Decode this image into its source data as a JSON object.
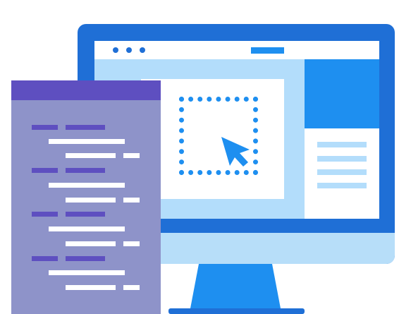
{
  "illustration": {
    "subject": "monitor-with-code-panel",
    "colors": {
      "monitor_frame": "#1f6fd6",
      "screen_background": "#b3ddfb",
      "accent_blue": "#1e8ff0",
      "code_panel": "#8e93c9",
      "code_accent": "#5e4fc0",
      "white": "#ffffff"
    },
    "icons": [
      "browser-dots-icon",
      "selection-box-icon",
      "cursor-arrow-icon",
      "code-lines-icon"
    ]
  }
}
